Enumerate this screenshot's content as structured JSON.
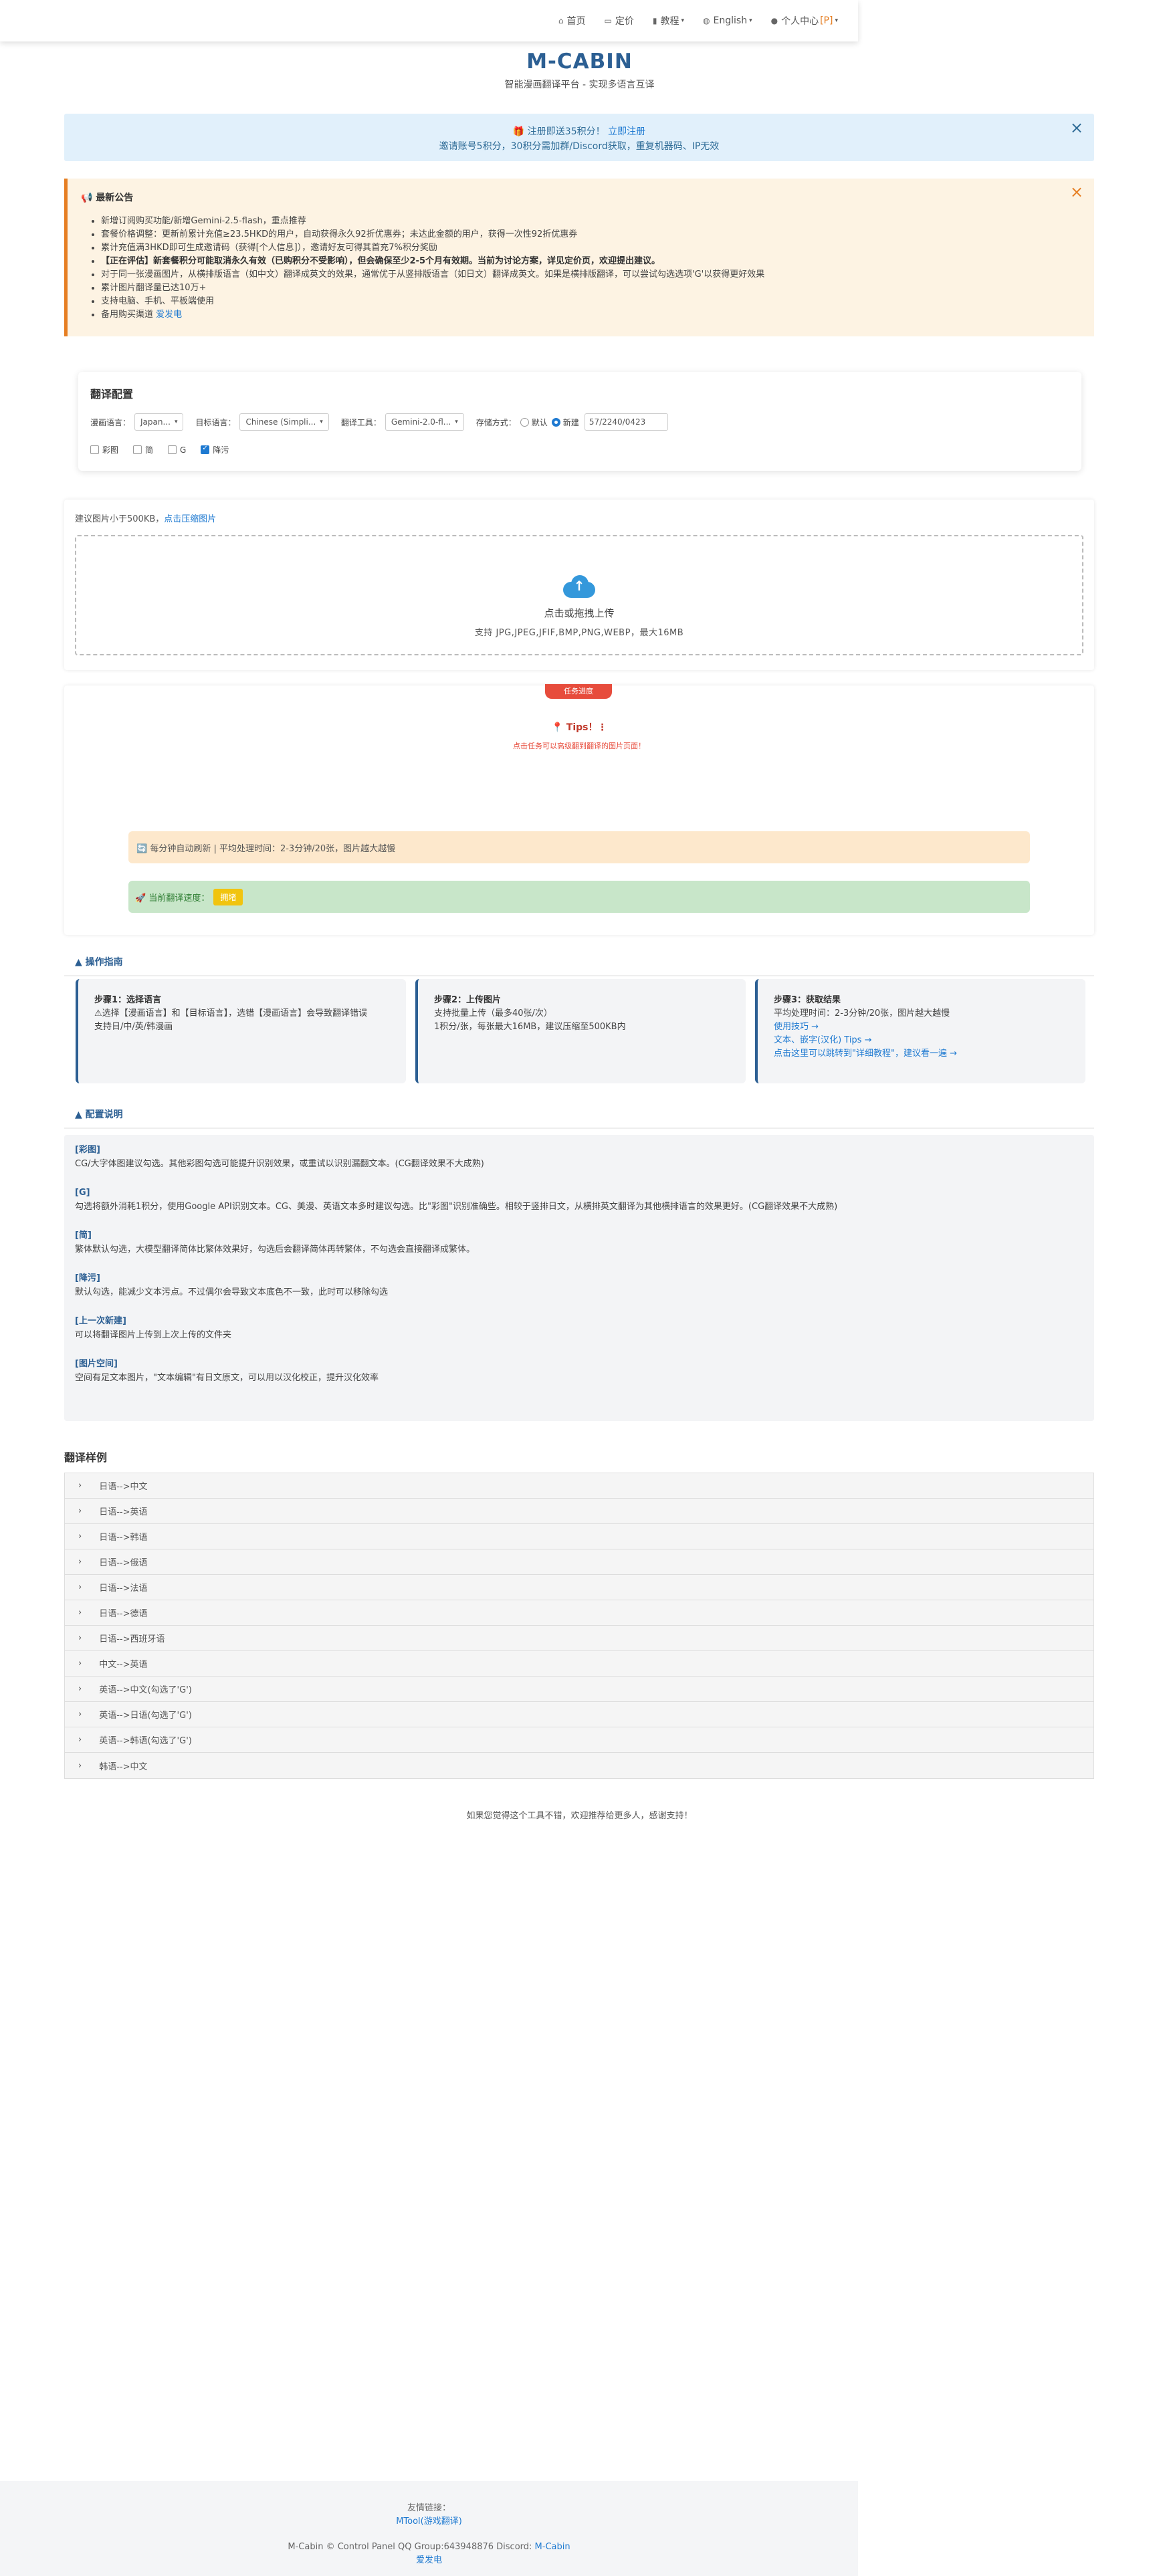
{
  "nav": {
    "home": "首页",
    "pricing": "定价",
    "tutorial": "教程",
    "language": "English",
    "user": "个人中心",
    "user_badge": "[P]"
  },
  "brand": {
    "title": "M-CABIN",
    "subtitle": "智能漫画翻译平台 - 实现多语言互译"
  },
  "register_banner": {
    "line1_prefix": "🎁 注册即送35积分！",
    "line1_link": "立即注册",
    "line2": "邀请账号5积分，30积分需加群/Discord获取，重复机器码、IP无效"
  },
  "notice": {
    "title": "📢 最新公告",
    "items": [
      "新增订阅购买功能/新增Gemini-2.5-flash，重点推荐",
      "套餐价格调整：更新前累计充值≥23.5HKD的用户，自动获得永久92折优惠券；未达此金额的用户，获得一次性92折优惠券",
      "累计充值满3HKD即可生成邀请码（获得[个人信息]），邀请好友可得其首充7%积分奖励",
      "【正在评估】新套餐积分可能取消永久有效（已购积分不受影响），但会确保至少2-5个月有效期。当前为讨论方案，详见定价页，欢迎提出建议。",
      "对于同一张漫画图片，从横排版语言（如中文）翻译成英文的效果，通常优于从竖排版语言（如日文）翻译成英文。如果是横排版翻译，可以尝试勾选选项'G'以获得更好效果",
      "累计图片翻译量已达10万+",
      "支持电脑、手机、平板端使用",
      "备用购买渠道"
    ],
    "link": "爱发电"
  },
  "config": {
    "title": "翻译配置",
    "source_label": "漫画语言：",
    "source_value": "Japan...",
    "target_label": "目标语言：",
    "target_value": "Chinese (Simpli...",
    "tool_label": "翻译工具：",
    "tool_value": "Gemini-2.0-fl...",
    "storage_label": "存储方式：",
    "storage_default": "默认",
    "storage_new": "新建",
    "storage_value": "57/2240/0423",
    "opt_color": "彩图",
    "opt_trad": "简",
    "opt_g": "G",
    "opt_clean": "降污"
  },
  "upload": {
    "hint": "建议图片小于500KB，",
    "hint_link": "点击压缩图片",
    "drop_title": "点击或拖拽上传",
    "drop_formats": "支持 JPG,JPEG,JFIF,BMP,PNG,WEBP，最大16MB"
  },
  "task": {
    "tag": "任务进度",
    "tips_title": "📍 Tips！⋮",
    "tips_sub": "点击任务可以高级翻到翻译的图片页面！",
    "refresh": "🔄 每分钟自动刷新 | 平均处理时间：2-3分钟/20张，图片越大越慢",
    "speed_label": "🚀 当前翻译速度：",
    "speed_value": "拥堵"
  },
  "guide": {
    "title": "▲ 操作指南",
    "steps": [
      {
        "title": "步骤1：选择语言",
        "lines": [
          "⚠选择【漫画语言】和【目标语言】，选错【漫画语言】会导致翻译错误",
          "支持日/中/英/韩漫画"
        ]
      },
      {
        "title": "步骤2：上传图片",
        "lines": [
          "支持批量上传（最多40张/次）",
          "1积分/张，每张最大16MB，建议压缩至500KB内"
        ]
      },
      {
        "title": "步骤3：获取结果",
        "lines": [
          "平均处理时间：2-3分钟/20张，图片越大越慢"
        ],
        "links": [
          "使用技巧 →",
          "文本、嵌字(汉化) Tips →",
          "点击这里可以跳转到\"详细教程\"，建议看一遍 →"
        ]
      }
    ]
  },
  "config_help": {
    "title": "▲ 配置说明",
    "items": [
      {
        "k": "[彩图]",
        "v": "CG/大字体图建议勾选。其他彩图勾选可能提升识别效果，或重试以识别漏翻文本。(CG翻译效果不大成熟)"
      },
      {
        "k": "[G]",
        "v": "勾选将额外消耗1积分，使用Google API识别文本。CG、美漫、英语文本多时建议勾选。比\"彩图\"识别准确些。相较于竖排日文，从横排英文翻译为其他横排语言的效果更好。(CG翻译效果不大成熟)"
      },
      {
        "k": "[简]",
        "v": "繁体默认勾选，大模型翻译简体比繁体效果好，勾选后会翻译简体再转繁体，不勾选会直接翻译成繁体。"
      },
      {
        "k": "[降污]",
        "v": "默认勾选，能减少文本污点。不过偶尔会导致文本底色不一致，此时可以移除勾选"
      },
      {
        "k": "[上一次新建]",
        "v": "可以将翻译图片上传到上次上传的文件夹"
      },
      {
        "k": "[图片空间]",
        "v": "空间有足文本图片，\"文本编辑\"有日文原文，可以用以汉化校正，提升汉化效率"
      }
    ]
  },
  "examples": {
    "title": "翻译样例",
    "rows": [
      "日语-->中文",
      "日语-->英语",
      "日语-->韩语",
      "日语-->俄语",
      "日语-->法语",
      "日语-->德语",
      "日语-->西班牙语",
      "中文-->英语",
      "英语-->中文(勾选了'G')",
      "英语-->日语(勾选了'G')",
      "英语-->韩语(勾选了'G')",
      "韩语-->中文"
    ]
  },
  "thanks": "如果您觉得这个工具不错，欢迎推荐给更多人，感谢支持！",
  "footer": {
    "friends_label": "友情链接：",
    "friends_link": "MTool(游戏翻译)",
    "copyright": "M-Cabin © Control Panel QQ Group:643948876 Discord:",
    "discord_link": "M-Cabin",
    "afdian": "爱发电"
  }
}
